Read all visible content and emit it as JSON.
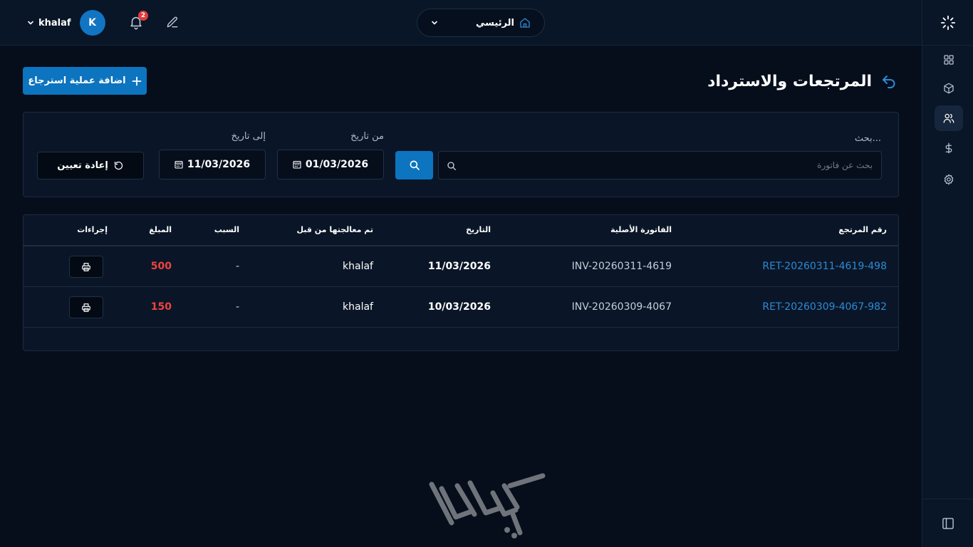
{
  "header": {
    "user_name": "khalaf",
    "avatar_initial": "K",
    "notification_count": "2",
    "home_label": "الرئيسي"
  },
  "page": {
    "title": "المرتجعات والاسترداد",
    "add_button_label": "اضافة عملية استرجاع"
  },
  "filters": {
    "search_label": "بحث...",
    "search_placeholder": "بحث عن فاتورة",
    "from_label": "من تاريخ",
    "from_value": "01/03/2026",
    "to_label": "إلى تاريخ",
    "to_value": "11/03/2026",
    "reset_label": "إعادة تعيين"
  },
  "table": {
    "columns": {
      "return_no": "رقم المرتجع",
      "original_invoice": "الفاتورة الأصلية",
      "date": "التاريخ",
      "processed_by": "تم معالجتها من قبل",
      "reason": "السبب",
      "amount": "المبلغ",
      "actions": "إجراءات"
    },
    "rows": [
      {
        "return_no": "RET-20260311-4619-498",
        "original_invoice": "INV-20260311-4619",
        "date": "11/03/2026",
        "processed_by": "khalaf",
        "reason": "-",
        "amount": "500"
      },
      {
        "return_no": "RET-20260309-4067-982",
        "original_invoice": "INV-20260309-4067",
        "date": "10/03/2026",
        "processed_by": "khalaf",
        "reason": "-",
        "amount": "150"
      }
    ]
  },
  "sidebar": {
    "items": [
      {
        "icon": "grid-icon"
      },
      {
        "icon": "box-icon"
      },
      {
        "icon": "users-icon",
        "active": true
      },
      {
        "icon": "dollar-icon"
      },
      {
        "icon": "gear-icon"
      }
    ],
    "collapse_icon": "sidebar-toggle-icon"
  },
  "colors": {
    "background": "#060e1c",
    "panel": "#0a1627",
    "accent": "#0d74bf",
    "link": "#2d8ad6",
    "amount": "#f0423f"
  }
}
